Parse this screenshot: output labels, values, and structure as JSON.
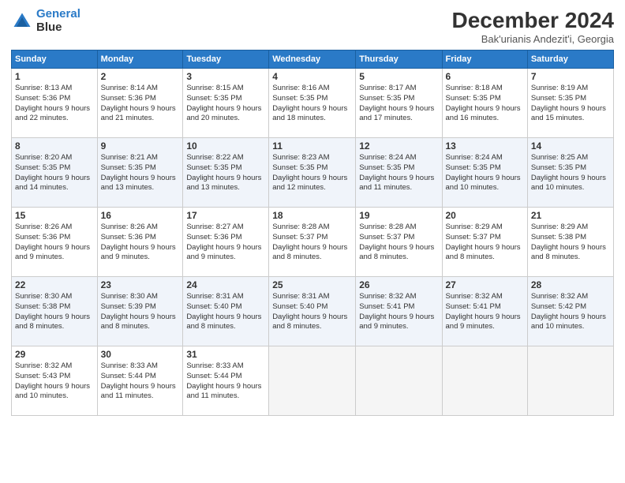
{
  "header": {
    "logo_line1": "General",
    "logo_line2": "Blue",
    "month_title": "December 2024",
    "location": "Bak'urianis Andezit'i, Georgia"
  },
  "days_of_week": [
    "Sunday",
    "Monday",
    "Tuesday",
    "Wednesday",
    "Thursday",
    "Friday",
    "Saturday"
  ],
  "weeks": [
    [
      {
        "day": "1",
        "sunrise": "8:13 AM",
        "sunset": "5:36 PM",
        "daylight": "9 hours and 22 minutes."
      },
      {
        "day": "2",
        "sunrise": "8:14 AM",
        "sunset": "5:36 PM",
        "daylight": "9 hours and 21 minutes."
      },
      {
        "day": "3",
        "sunrise": "8:15 AM",
        "sunset": "5:35 PM",
        "daylight": "9 hours and 20 minutes."
      },
      {
        "day": "4",
        "sunrise": "8:16 AM",
        "sunset": "5:35 PM",
        "daylight": "9 hours and 18 minutes."
      },
      {
        "day": "5",
        "sunrise": "8:17 AM",
        "sunset": "5:35 PM",
        "daylight": "9 hours and 17 minutes."
      },
      {
        "day": "6",
        "sunrise": "8:18 AM",
        "sunset": "5:35 PM",
        "daylight": "9 hours and 16 minutes."
      },
      {
        "day": "7",
        "sunrise": "8:19 AM",
        "sunset": "5:35 PM",
        "daylight": "9 hours and 15 minutes."
      }
    ],
    [
      {
        "day": "8",
        "sunrise": "8:20 AM",
        "sunset": "5:35 PM",
        "daylight": "9 hours and 14 minutes."
      },
      {
        "day": "9",
        "sunrise": "8:21 AM",
        "sunset": "5:35 PM",
        "daylight": "9 hours and 13 minutes."
      },
      {
        "day": "10",
        "sunrise": "8:22 AM",
        "sunset": "5:35 PM",
        "daylight": "9 hours and 13 minutes."
      },
      {
        "day": "11",
        "sunrise": "8:23 AM",
        "sunset": "5:35 PM",
        "daylight": "9 hours and 12 minutes."
      },
      {
        "day": "12",
        "sunrise": "8:24 AM",
        "sunset": "5:35 PM",
        "daylight": "9 hours and 11 minutes."
      },
      {
        "day": "13",
        "sunrise": "8:24 AM",
        "sunset": "5:35 PM",
        "daylight": "9 hours and 10 minutes."
      },
      {
        "day": "14",
        "sunrise": "8:25 AM",
        "sunset": "5:35 PM",
        "daylight": "9 hours and 10 minutes."
      }
    ],
    [
      {
        "day": "15",
        "sunrise": "8:26 AM",
        "sunset": "5:36 PM",
        "daylight": "9 hours and 9 minutes."
      },
      {
        "day": "16",
        "sunrise": "8:26 AM",
        "sunset": "5:36 PM",
        "daylight": "9 hours and 9 minutes."
      },
      {
        "day": "17",
        "sunrise": "8:27 AM",
        "sunset": "5:36 PM",
        "daylight": "9 hours and 9 minutes."
      },
      {
        "day": "18",
        "sunrise": "8:28 AM",
        "sunset": "5:37 PM",
        "daylight": "9 hours and 8 minutes."
      },
      {
        "day": "19",
        "sunrise": "8:28 AM",
        "sunset": "5:37 PM",
        "daylight": "9 hours and 8 minutes."
      },
      {
        "day": "20",
        "sunrise": "8:29 AM",
        "sunset": "5:37 PM",
        "daylight": "9 hours and 8 minutes."
      },
      {
        "day": "21",
        "sunrise": "8:29 AM",
        "sunset": "5:38 PM",
        "daylight": "9 hours and 8 minutes."
      }
    ],
    [
      {
        "day": "22",
        "sunrise": "8:30 AM",
        "sunset": "5:38 PM",
        "daylight": "9 hours and 8 minutes."
      },
      {
        "day": "23",
        "sunrise": "8:30 AM",
        "sunset": "5:39 PM",
        "daylight": "9 hours and 8 minutes."
      },
      {
        "day": "24",
        "sunrise": "8:31 AM",
        "sunset": "5:40 PM",
        "daylight": "9 hours and 8 minutes."
      },
      {
        "day": "25",
        "sunrise": "8:31 AM",
        "sunset": "5:40 PM",
        "daylight": "9 hours and 8 minutes."
      },
      {
        "day": "26",
        "sunrise": "8:32 AM",
        "sunset": "5:41 PM",
        "daylight": "9 hours and 9 minutes."
      },
      {
        "day": "27",
        "sunrise": "8:32 AM",
        "sunset": "5:41 PM",
        "daylight": "9 hours and 9 minutes."
      },
      {
        "day": "28",
        "sunrise": "8:32 AM",
        "sunset": "5:42 PM",
        "daylight": "9 hours and 10 minutes."
      }
    ],
    [
      {
        "day": "29",
        "sunrise": "8:32 AM",
        "sunset": "5:43 PM",
        "daylight": "9 hours and 10 minutes."
      },
      {
        "day": "30",
        "sunrise": "8:33 AM",
        "sunset": "5:44 PM",
        "daylight": "9 hours and 11 minutes."
      },
      {
        "day": "31",
        "sunrise": "8:33 AM",
        "sunset": "5:44 PM",
        "daylight": "9 hours and 11 minutes."
      },
      null,
      null,
      null,
      null
    ]
  ]
}
